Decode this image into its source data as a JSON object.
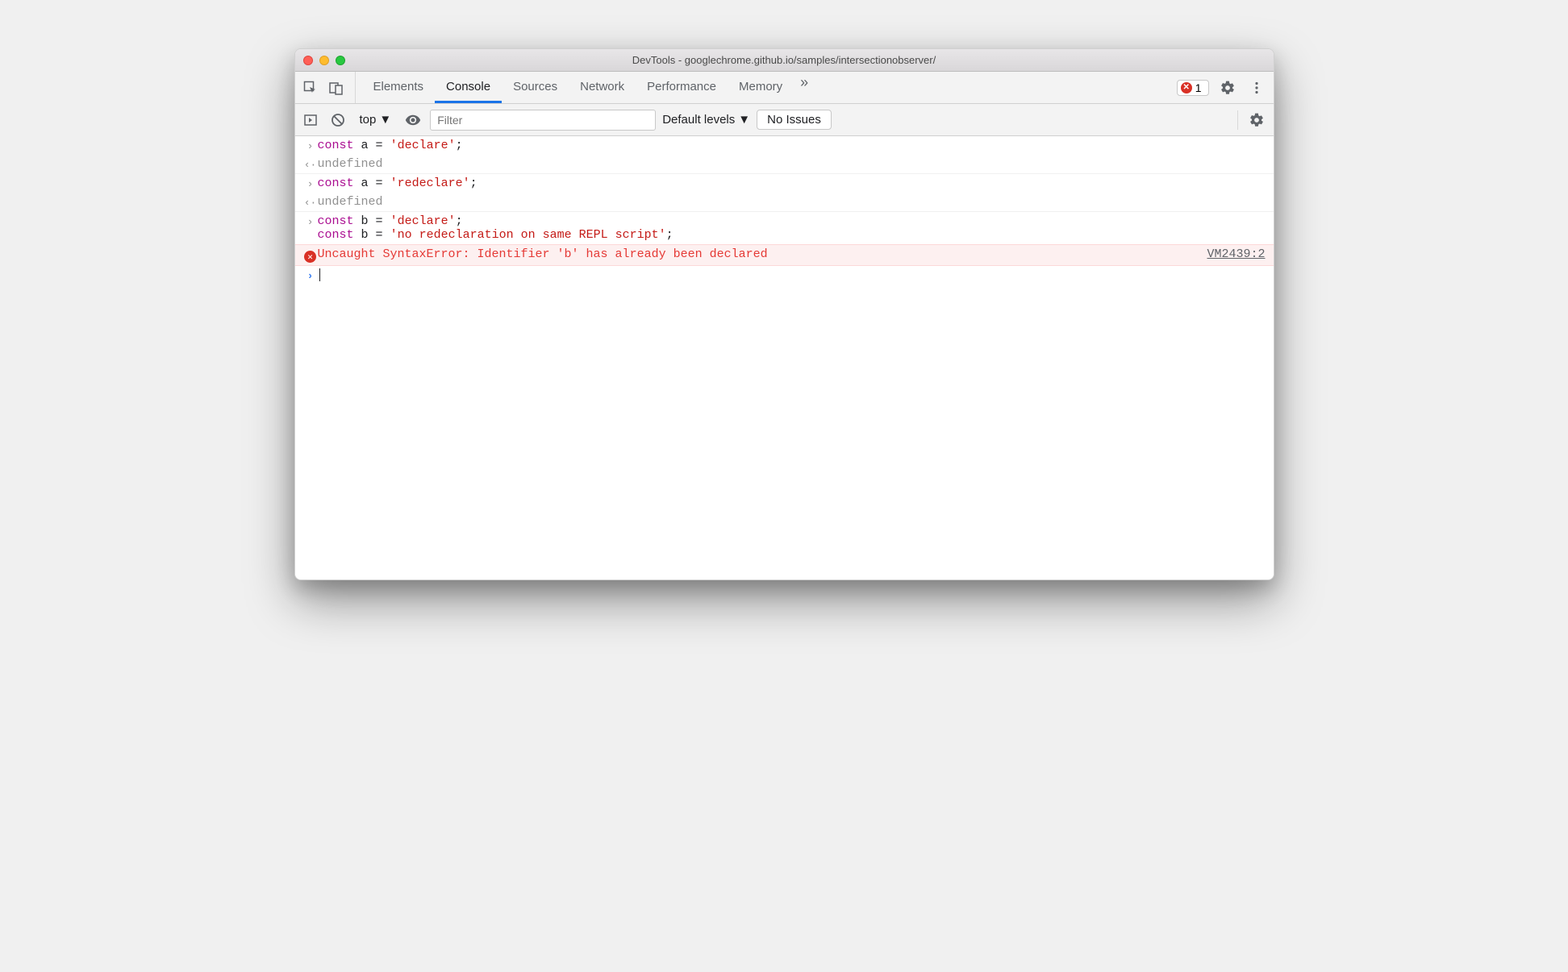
{
  "window": {
    "title": "DevTools - googlechrome.github.io/samples/intersectionobserver/"
  },
  "tabs": {
    "items": [
      "Elements",
      "Console",
      "Sources",
      "Network",
      "Performance",
      "Memory"
    ],
    "active": "Console",
    "overflow": "»"
  },
  "error_badge": {
    "count": "1"
  },
  "sub": {
    "context": "top",
    "filter_placeholder": "Filter",
    "level": "Default levels",
    "issues": "No Issues"
  },
  "console": {
    "entries": [
      {
        "type": "input",
        "tokens": [
          {
            "t": "kw",
            "v": "const"
          },
          {
            "t": "op",
            "v": " a "
          },
          {
            "t": "op",
            "v": "="
          },
          {
            "t": "op",
            "v": " "
          },
          {
            "t": "str",
            "v": "'declare'"
          },
          {
            "t": "op",
            "v": ";"
          }
        ]
      },
      {
        "type": "output",
        "text": "undefined"
      },
      {
        "type": "input",
        "tokens": [
          {
            "t": "kw",
            "v": "const"
          },
          {
            "t": "op",
            "v": " a "
          },
          {
            "t": "op",
            "v": "="
          },
          {
            "t": "op",
            "v": " "
          },
          {
            "t": "str",
            "v": "'redeclare'"
          },
          {
            "t": "op",
            "v": ";"
          }
        ]
      },
      {
        "type": "output",
        "text": "undefined"
      },
      {
        "type": "input-multi",
        "lines": [
          [
            {
              "t": "kw",
              "v": "const"
            },
            {
              "t": "op",
              "v": " b "
            },
            {
              "t": "op",
              "v": "="
            },
            {
              "t": "op",
              "v": " "
            },
            {
              "t": "str",
              "v": "'declare'"
            },
            {
              "t": "op",
              "v": ";"
            }
          ],
          [
            {
              "t": "kw",
              "v": "const"
            },
            {
              "t": "op",
              "v": " b "
            },
            {
              "t": "op",
              "v": "="
            },
            {
              "t": "op",
              "v": " "
            },
            {
              "t": "str",
              "v": "'no redeclaration on same REPL script'"
            },
            {
              "t": "op",
              "v": ";"
            }
          ]
        ]
      },
      {
        "type": "error",
        "text": "Uncaught SyntaxError: Identifier 'b' has already been declared",
        "source": "VM2439:2"
      },
      {
        "type": "prompt"
      }
    ]
  }
}
